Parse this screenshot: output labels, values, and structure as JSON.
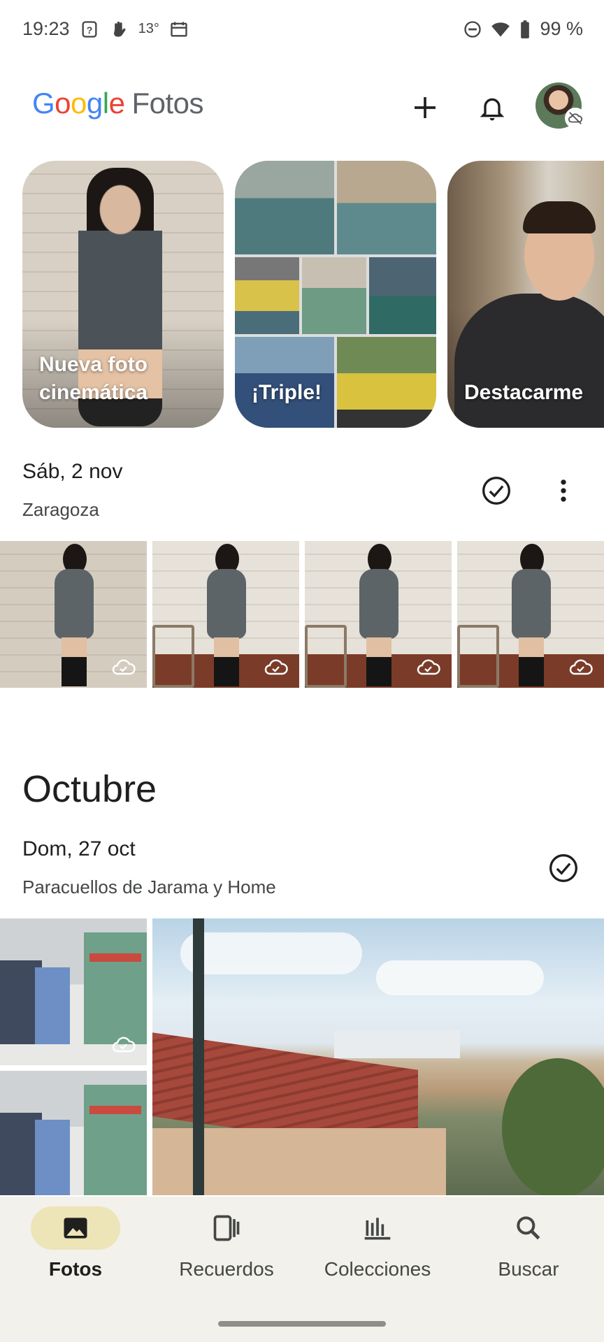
{
  "status_bar": {
    "time": "19:23",
    "temperature": "13°",
    "battery": "99 %",
    "icons_left": [
      "help-box-icon",
      "hand-icon",
      "calendar-icon"
    ],
    "icons_right": [
      "do-not-disturb-icon",
      "wifi-icon",
      "battery-icon"
    ]
  },
  "app_bar": {
    "logo_google": "Google",
    "logo_product": "Fotos",
    "logo_colors": [
      "#4285F4",
      "#EA4335",
      "#FBBC05",
      "#4285F4",
      "#34A853",
      "#EA4335"
    ],
    "actions": [
      "add-icon",
      "bell-icon",
      "avatar"
    ]
  },
  "memories": [
    {
      "label": "Nueva foto cinemática"
    },
    {
      "label": "¡Triple!"
    },
    {
      "label": "Destacarme"
    }
  ],
  "sections": [
    {
      "date": "Sáb, 2 nov",
      "location": "Zaragoza",
      "photo_count_visible": 4
    },
    {
      "month": "Octubre",
      "date": "Dom, 27 oct",
      "location": "Paracuellos de Jarama y Home"
    }
  ],
  "bottom_nav": {
    "items": [
      {
        "label": "Fotos",
        "icon": "photo-icon",
        "active": true
      },
      {
        "label": "Recuerdos",
        "icon": "memories-icon",
        "active": false
      },
      {
        "label": "Colecciones",
        "icon": "collections-icon",
        "active": false
      },
      {
        "label": "Buscar",
        "icon": "search-icon",
        "active": false
      }
    ],
    "active_color": "#ede4b8",
    "background": "#f2f1eb"
  }
}
